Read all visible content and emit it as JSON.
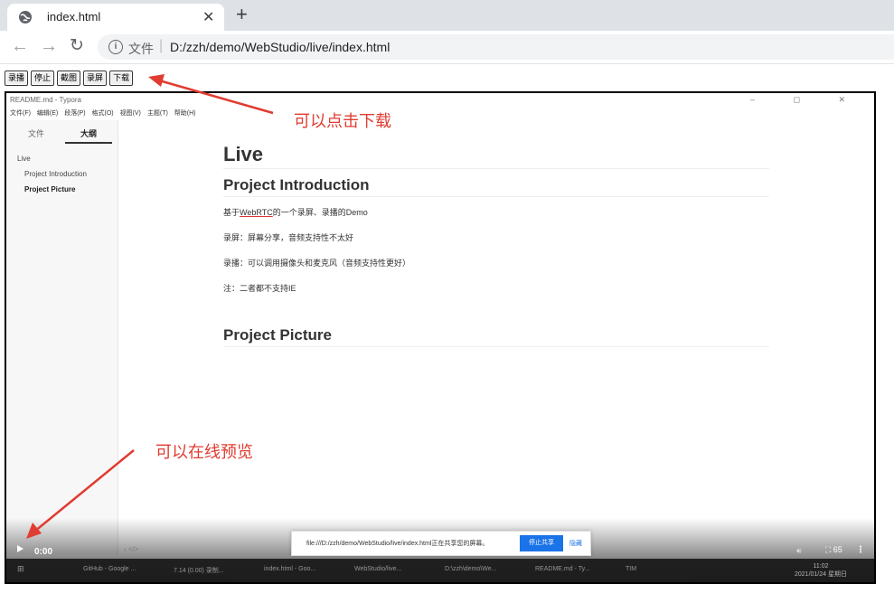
{
  "browser": {
    "tab_title": "index.html",
    "new_tab_label": "+",
    "close_label": "✕",
    "back_label": "←",
    "forward_label": "→",
    "reload_label": "↻",
    "scheme_label": "文件",
    "url": "D:/zzh/demo/WebStudio/live/index.html"
  },
  "page_buttons": [
    "录播",
    "停止",
    "截图",
    "录屏",
    "下载"
  ],
  "annotations": {
    "download_note": "可以点击下载",
    "preview_note": "可以在线预览"
  },
  "typora": {
    "window_title": "README.md - Typora",
    "window_controls": "– ◻ ✕",
    "menu": [
      "文件(F)",
      "编辑(E)",
      "段落(P)",
      "格式(O)",
      "视图(V)",
      "主题(T)",
      "帮助(H)"
    ],
    "sidebar_tabs": [
      "文件",
      "大纲"
    ],
    "outline": [
      "Live",
      "Project Introduction",
      "Project Picture"
    ],
    "doc": {
      "h1": "Live",
      "h2_intro": "Project Introduction",
      "para1_prefix": "基于",
      "para1_link": "WebRTC",
      "para1_suffix": "的一个录屏、录播的Demo",
      "para2": "录屏：屏幕分享，音频支持性不太好",
      "para3": "录播：可以调用摄像头和麦克风（音频支持性更好）",
      "para4": "注：二者都不支持IE",
      "h2_picture": "Project Picture"
    },
    "status_icons": "‹  </>"
  },
  "share_bar": {
    "message": "file:///D:/zzh/demo/WebStudio/live/index.html正在共享您的屏幕。",
    "stop_label": "停止共享",
    "hide_label": "隐藏"
  },
  "video": {
    "time": "0:00",
    "play_label": "▶",
    "fullscreen_label": "⛶ 65 ",
    "more_label": "⋮"
  },
  "taskbar": {
    "items": [
      "GitHub - Google ...",
      "7.14 (0.00) 录制...",
      "index.html - Goo...",
      "WebStudio/live...",
      "D:\\zzh\\demo\\We...",
      "README.md - Ty...",
      "TIM"
    ],
    "clock_time": "11:02",
    "clock_date": "2021/01/24 星期日"
  }
}
